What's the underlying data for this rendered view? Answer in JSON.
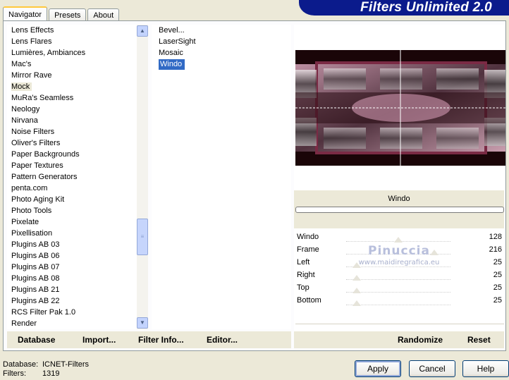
{
  "app": {
    "title": "Filters Unlimited 2.0"
  },
  "tabs": [
    {
      "label": "Navigator",
      "active": true
    },
    {
      "label": "Presets",
      "active": false
    },
    {
      "label": "About",
      "active": false
    }
  ],
  "categories": {
    "items": [
      "Lens Effects",
      "Lens Flares",
      "Lumières, Ambiances",
      "Mac's",
      "Mirror Rave",
      "Mock",
      "MuRa's Seamless",
      "Neology",
      "Nirvana",
      "Noise Filters",
      "Oliver's Filters",
      "Paper Backgrounds",
      "Paper Textures",
      "Pattern Generators",
      "penta.com",
      "Photo Aging Kit",
      "Photo Tools",
      "Pixelate",
      "Pixellisation",
      "Plugins AB 03",
      "Plugins AB 06",
      "Plugins AB 07",
      "Plugins AB 08",
      "Plugins AB 21",
      "Plugins AB 22",
      "RCS Filter Pak 1.0",
      "Render"
    ],
    "selected": "Mock"
  },
  "filters": {
    "items": [
      "Bevel...",
      "LaserSight",
      "Mosaic",
      "Windo"
    ],
    "selected": "Windo"
  },
  "left_buttons": {
    "database": "Database",
    "import": "Import...",
    "filter_info": "Filter Info...",
    "editor": "Editor..."
  },
  "current_filter": {
    "name": "Windo",
    "progress": 0
  },
  "params": [
    {
      "name": "Windo",
      "value": "128",
      "level": 0.502
    },
    {
      "name": "Frame",
      "value": "216",
      "level": 0.847
    },
    {
      "name": "Left",
      "value": "25",
      "level": 0.098
    },
    {
      "name": "Right",
      "value": "25",
      "level": 0.098
    },
    {
      "name": "Top",
      "value": "25",
      "level": 0.098
    },
    {
      "name": "Bottom",
      "value": "25",
      "level": 0.098
    }
  ],
  "watermark": {
    "line1": "Pinuccia",
    "line2": "www.maidiregrafica.eu"
  },
  "right_buttons": {
    "randomize": "Randomize",
    "reset": "Reset"
  },
  "footer": {
    "database_label": "Database:",
    "database_value": "ICNET-Filters",
    "filters_label": "Filters:",
    "filters_value": "1319"
  },
  "dialog_buttons": {
    "apply": "Apply",
    "cancel": "Cancel",
    "help": "Help"
  },
  "icons": {
    "scroll_up": "chevron-up-icon",
    "scroll_down": "chevron-down-icon",
    "scroll_grip": "grip-icon"
  }
}
